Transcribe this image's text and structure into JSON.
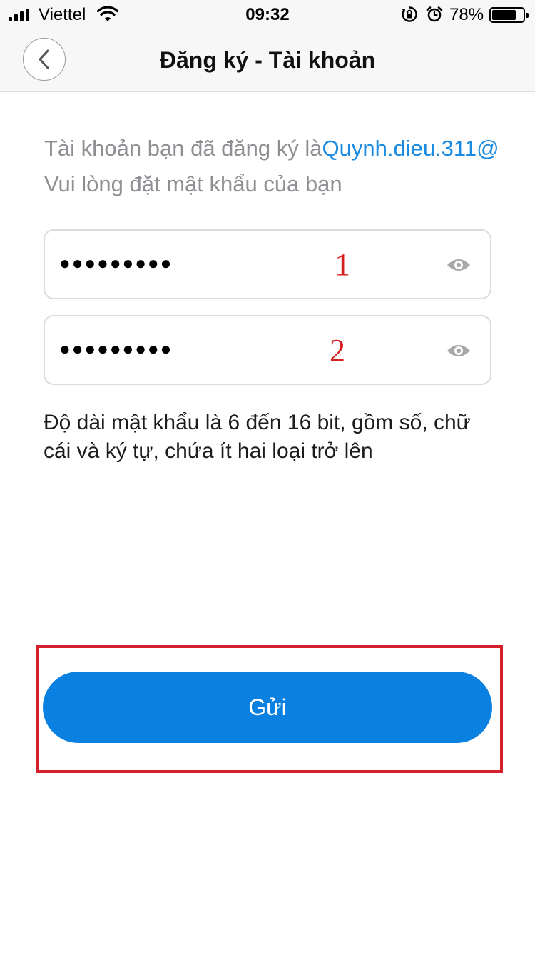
{
  "status_bar": {
    "carrier": "Viettel",
    "time": "09:32",
    "battery_percent": "78%",
    "battery_level": 0.78,
    "icons": [
      "signal-icon",
      "wifi-icon",
      "orientation-lock-icon",
      "alarm-icon",
      "battery-icon"
    ]
  },
  "nav": {
    "title": "Đăng ký - Tài khoản",
    "back_icon": "chevron-left-icon"
  },
  "content": {
    "account_prefix": "Tài khoản bạn đã đăng ký là",
    "account_email": "Quynh.dieu.311@",
    "instruction": "Vui lòng đặt mật khẩu của bạn",
    "password_fields": [
      {
        "value": "●●●●●●●●●",
        "marker": "1",
        "toggle_icon": "eye-icon"
      },
      {
        "value": "●●●●●●●●●",
        "marker": "2",
        "toggle_icon": "eye-icon"
      }
    ],
    "hint": "Độ dài mật khẩu là 6 đến 16 bit, gồm số, chữ cái và ký tự, chứa ít hai loại trở lên"
  },
  "submit": {
    "label": "Gửi"
  },
  "colors": {
    "accent": "#0a80e0",
    "link": "#1a8be0",
    "annotation": "#d61f2c",
    "muted_text": "#8e8e93"
  }
}
